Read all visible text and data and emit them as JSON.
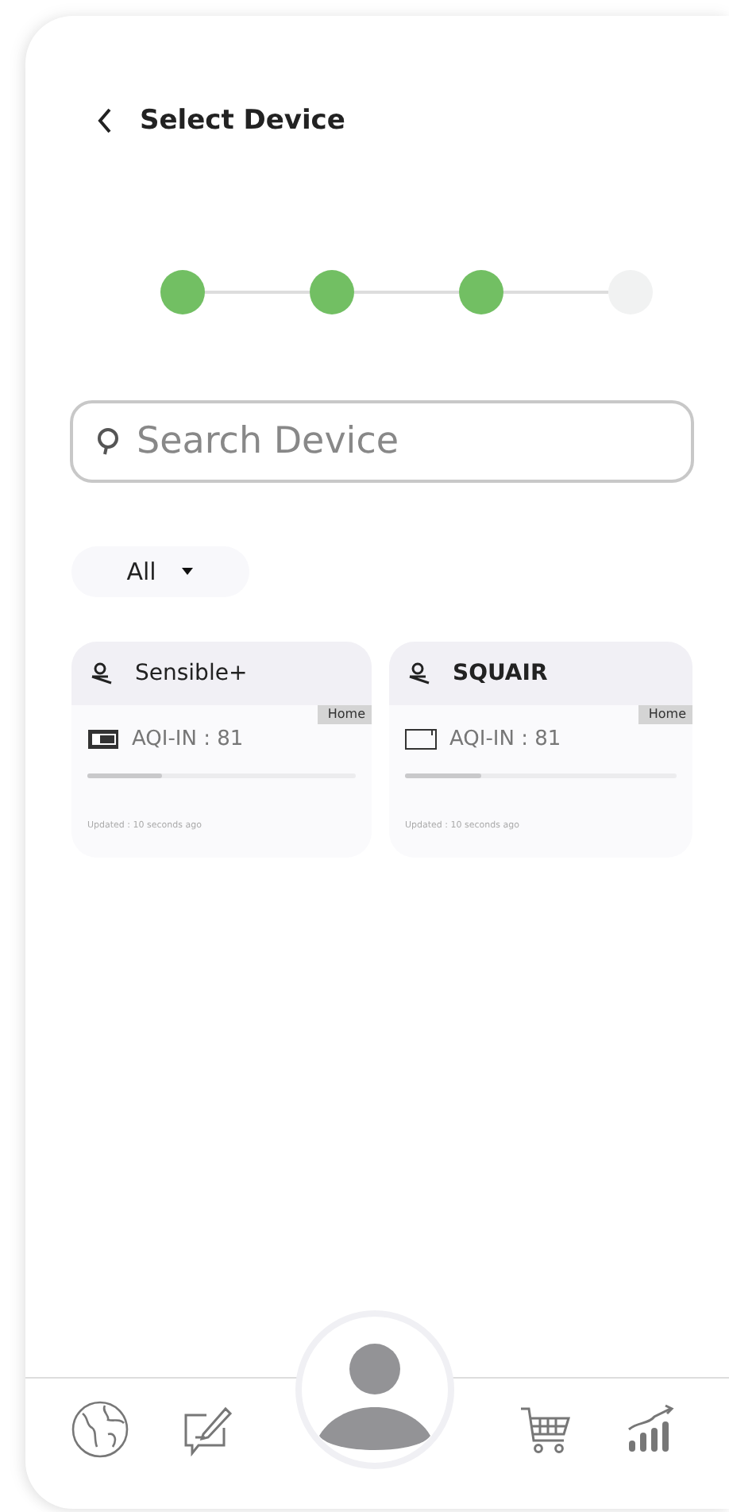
{
  "header": {
    "title": "Select Device"
  },
  "steps": [
    {
      "completed": true
    },
    {
      "completed": true
    },
    {
      "completed": true
    },
    {
      "completed": false
    }
  ],
  "search": {
    "placeholder": "Search Device"
  },
  "filter": {
    "value": "All"
  },
  "devices": [
    {
      "name": "Sensible+",
      "bold": false,
      "tag": "Home",
      "kind": "display",
      "reading": "AQI-IN : 81",
      "level": 0.28,
      "updated": "Updated : 10 seconds ago"
    },
    {
      "name": "SQUAIR",
      "bold": true,
      "tag": "Home",
      "kind": "outline",
      "reading": "AQI-IN : 81",
      "level": 0.28,
      "updated": "Updated : 10 seconds ago"
    }
  ]
}
